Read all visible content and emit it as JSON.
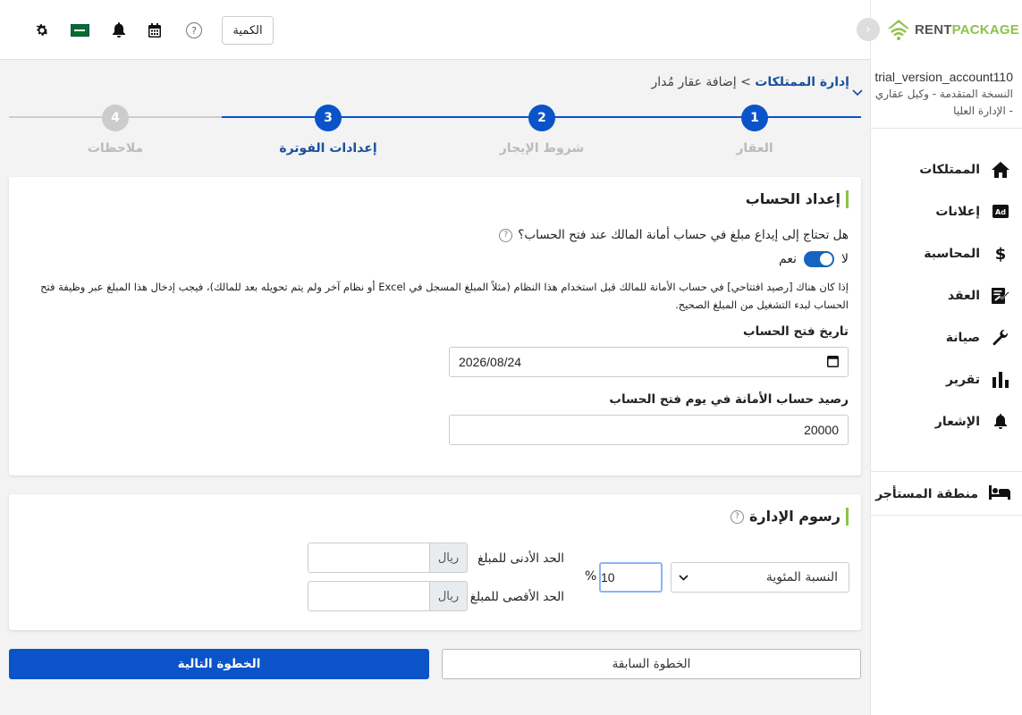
{
  "colors": {
    "primary": "#0b53c8",
    "accent": "#8bc34a",
    "step_inactive": "#cccccc"
  },
  "topbar": {
    "qty_button": "الكمية",
    "help_glyph": "?",
    "icons": [
      "settings-icon",
      "saudi-flag-icon",
      "bell-icon",
      "calendar-icon",
      "help-icon"
    ]
  },
  "sidebar": {
    "logo": {
      "rent": "RENT",
      "package": "PACKAGE"
    },
    "account_name": "trial_version_account110",
    "account_role": "النسخة المتقدمة - وكيل عقاري - الإدارة العليا",
    "nav": [
      {
        "label": "الممتلكات",
        "icon": "home-icon"
      },
      {
        "label": "إعلانات",
        "icon": "ad-icon"
      },
      {
        "label": "المحاسبة",
        "icon": "dollar-icon"
      },
      {
        "label": "العقد",
        "icon": "contract-icon"
      },
      {
        "label": "صيانة",
        "icon": "wrench-icon"
      },
      {
        "label": "تقرير",
        "icon": "bar-chart-icon"
      },
      {
        "label": "الإشعار",
        "icon": "bell-icon"
      }
    ],
    "tenant_area": "منطقة المستأجر"
  },
  "breadcrumb": {
    "parent": "إدارة الممتلكات",
    "separator": ">",
    "current": "إضافة عقار مُدار"
  },
  "stepper": {
    "steps": [
      {
        "number": "1",
        "label": "العقار",
        "state": "done"
      },
      {
        "number": "2",
        "label": "شروط الإيجار",
        "state": "done"
      },
      {
        "number": "3",
        "label": "إعدادات الفوترة",
        "state": "current"
      },
      {
        "number": "4",
        "label": "ملاحظات",
        "state": "pending"
      }
    ]
  },
  "account_setup": {
    "title": "إعداد الحساب",
    "question": "هل تحتاج إلى إيداع مبلغ في حساب أمانة المالك عند فتح الحساب؟",
    "toggle_no": "لا",
    "toggle_yes": "نعم",
    "toggle_value": "yes",
    "note": "إذا كان هناك [رصيد افتتاحي] في حساب الأمانة للمالك قبل استخدام هذا النظام (مثلاً المبلغ المسجل في Excel أو نظام آخر ولم يتم تحويله بعد للمالك)، فيجب إدخال هذا المبلغ عبر وظيفة فتح الحساب لبدء التشغيل من المبلغ الصحيح.",
    "open_date_label": "تاريخ فتح الحساب",
    "open_date_value": "2026/08/24",
    "balance_label": "رصيد حساب الأمانة في يوم فتح الحساب",
    "balance_value": "20000"
  },
  "management_fees": {
    "title": "رسوم الإدارة",
    "type_selected": "النسبة المئوية",
    "percent_value": "10",
    "percent_sign": "%",
    "min_label": "الحد الأدنى للمبلغ",
    "max_label": "الحد الأقصى للمبلغ",
    "currency": "ريال",
    "min_value": "",
    "max_value": ""
  },
  "actions": {
    "next": "الخطوة التالية",
    "prev": "الخطوة السابقة"
  }
}
